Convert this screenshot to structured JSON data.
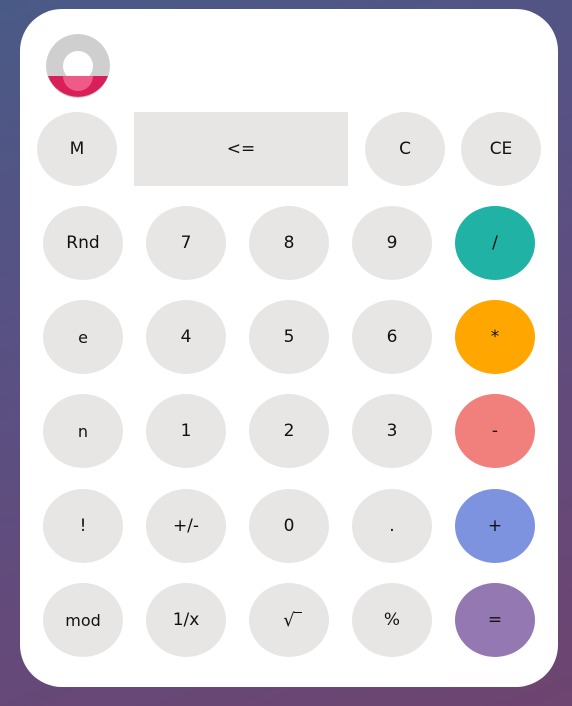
{
  "colors": {
    "key": "#e8e6e5",
    "divide": "#21b2a6",
    "multiply": "#ffa600",
    "minus": "#f17f7c",
    "plus": "#7e93e0",
    "equals": "#9378b1",
    "logo_ring": "#cfcfcf",
    "logo_accent": "#d81f5a"
  },
  "logo": {
    "icon": "logo-icon"
  },
  "keys": {
    "memory": "M",
    "backspace": "<=",
    "clear": "C",
    "clear_entry": "CE",
    "random": "Rnd",
    "seven": "7",
    "eight": "8",
    "nine": "9",
    "divide": "/",
    "euler": "e",
    "four": "4",
    "five": "5",
    "six": "6",
    "multiply": "*",
    "pi": "n",
    "one": "1",
    "two": "2",
    "three": "3",
    "minus": "-",
    "factorial": "!",
    "negate": "+/-",
    "zero": "0",
    "decimal": ".",
    "plus": "+",
    "modulo": "mod",
    "reciprocal": "1/x",
    "sqrt": "√",
    "percent": "%",
    "equals": "="
  }
}
